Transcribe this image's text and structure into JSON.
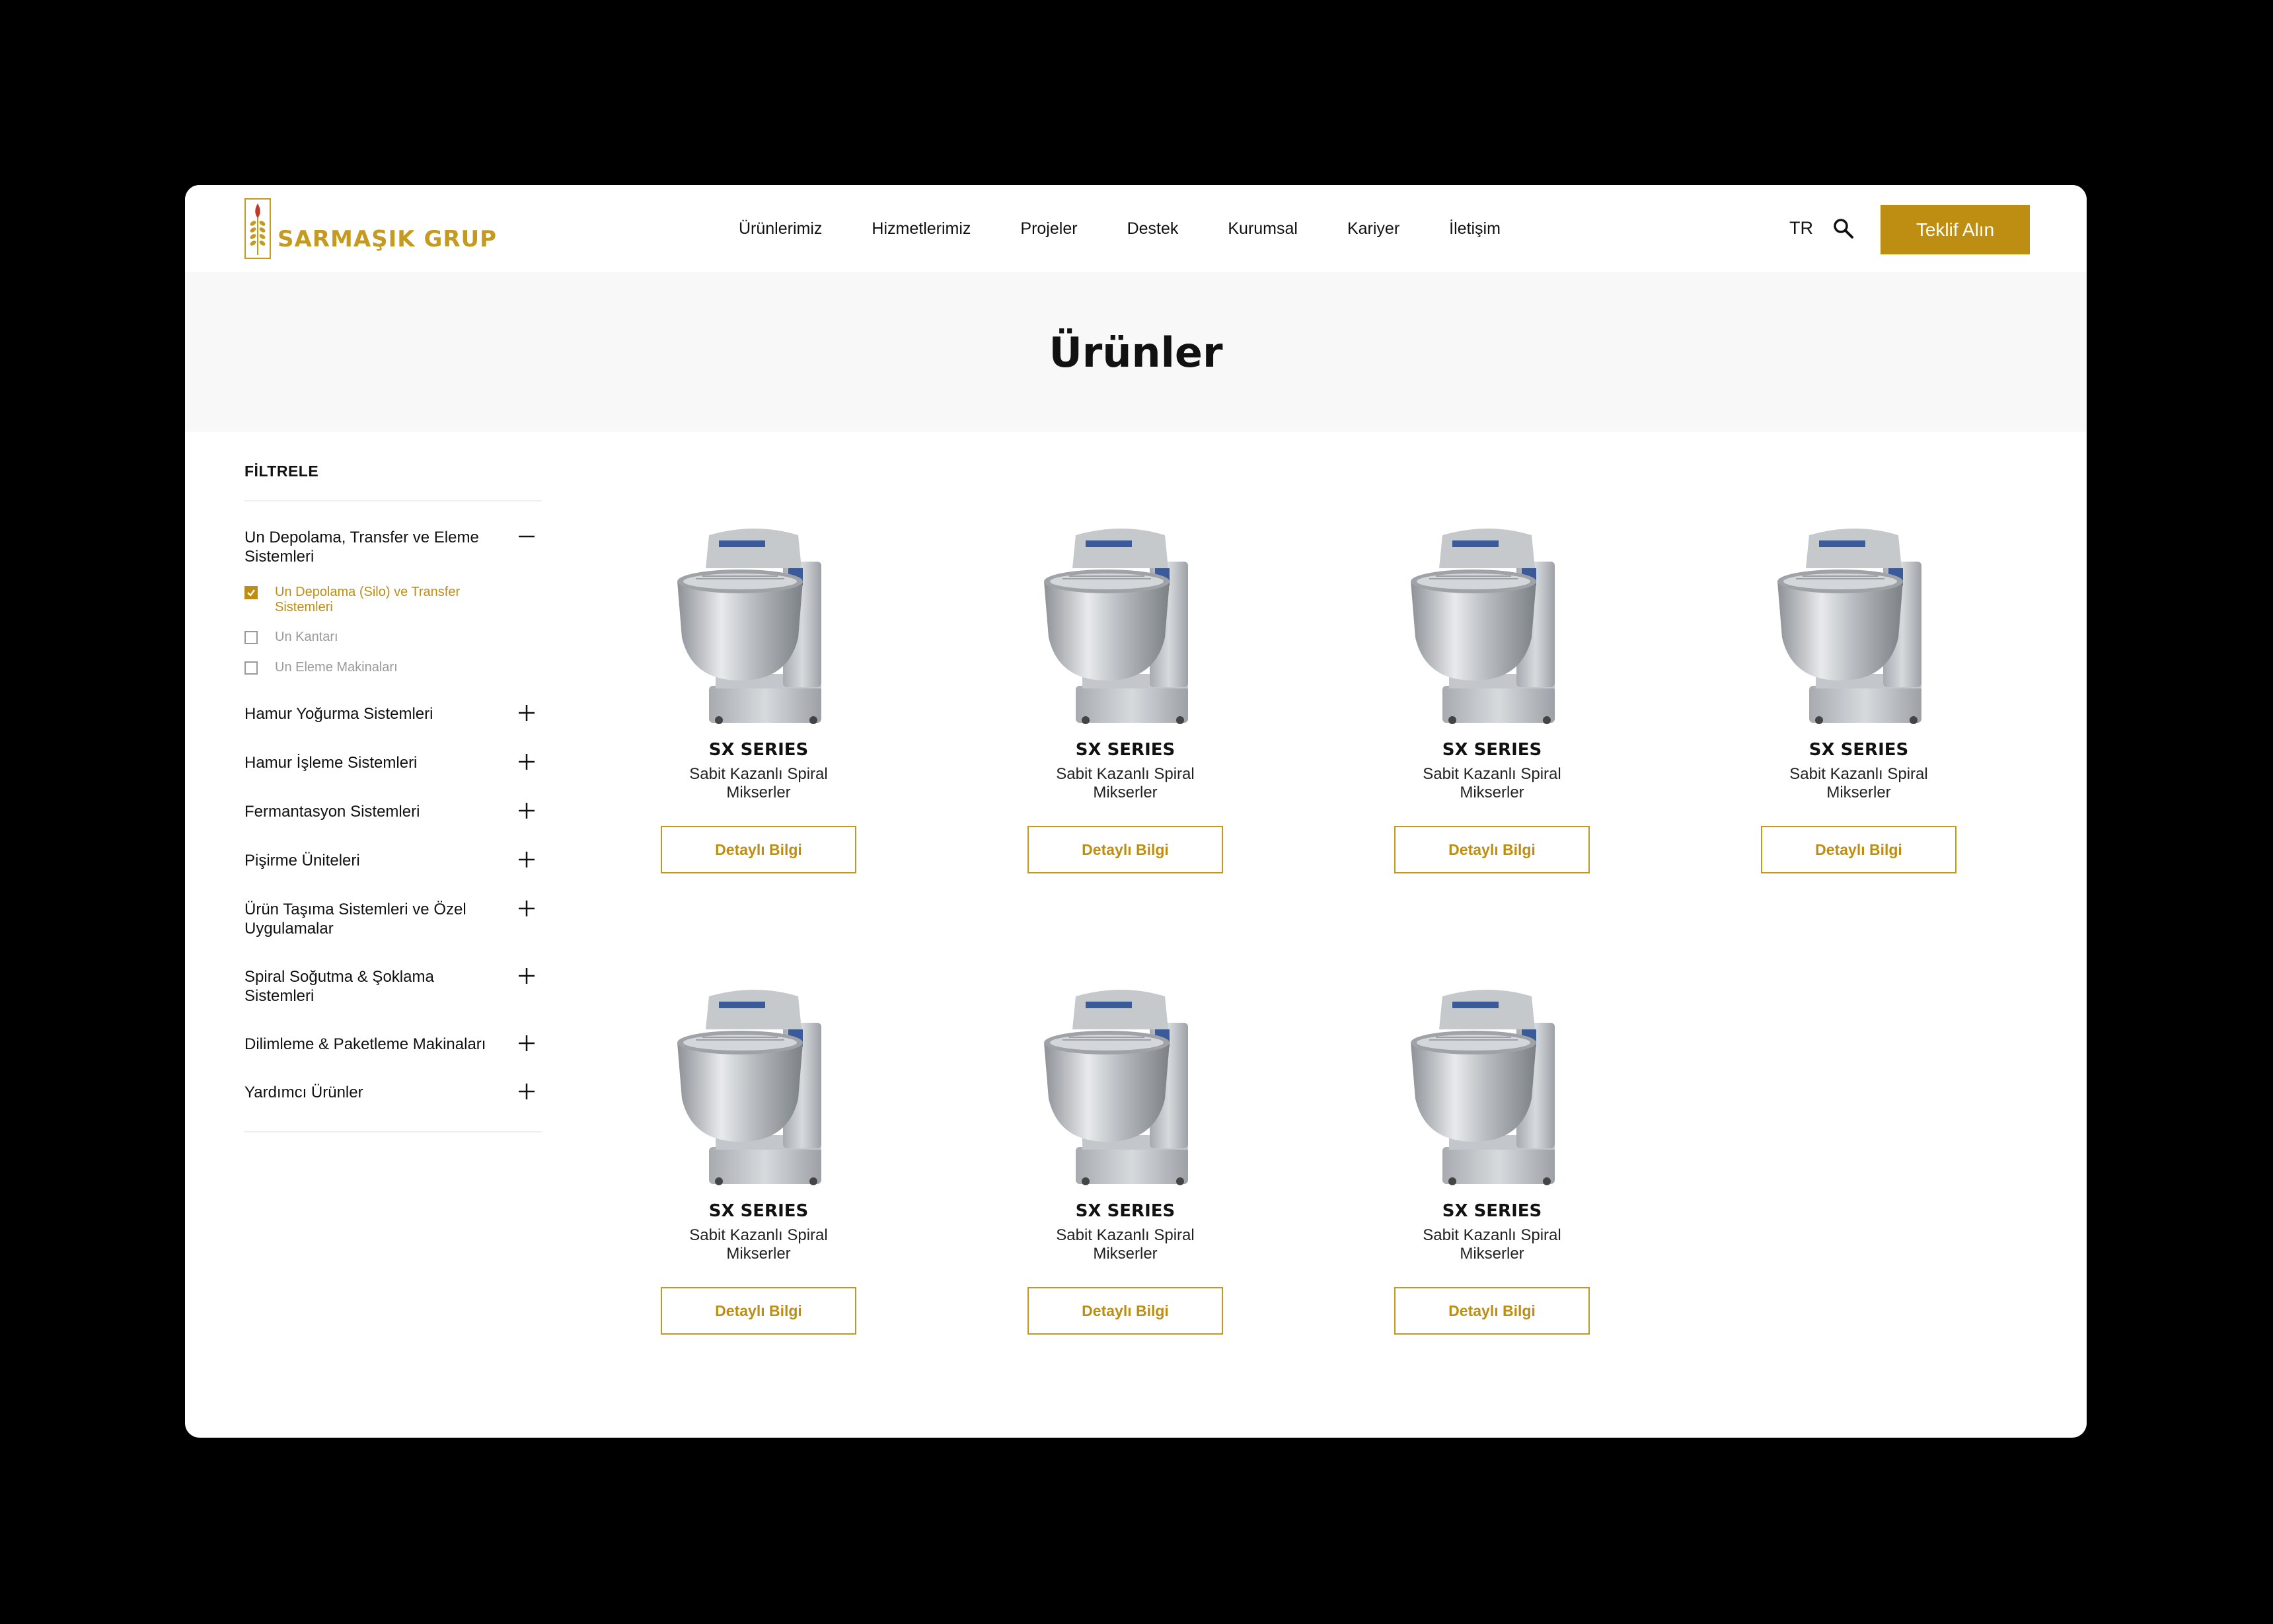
{
  "brand": {
    "name": "SARMAŞIK GRUP",
    "accent": "#bd8e12",
    "logo_icon": "wheat-logo-icon"
  },
  "nav": {
    "items": [
      "Ürünlerimiz",
      "Hizmetlerimiz",
      "Projeler",
      "Destek",
      "Kurumsal",
      "Kariyer",
      "İletişim"
    ]
  },
  "header": {
    "lang": "TR",
    "search_icon": "search-icon",
    "cta": "Teklif Alın"
  },
  "hero": {
    "title": "Ürünler"
  },
  "filter": {
    "title": "FİLTRELE",
    "categories": [
      {
        "label": "Un Depolama, Transfer ve Eleme Sistemleri",
        "expanded": true,
        "subs": [
          {
            "label": "Un Depolama (Silo) ve Transfer Sistemleri",
            "checked": true
          },
          {
            "label": "Un Kantarı",
            "checked": false
          },
          {
            "label": "Un Eleme Makinaları",
            "checked": false
          }
        ]
      },
      {
        "label": "Hamur Yoğurma Sistemleri",
        "expanded": false
      },
      {
        "label": "Hamur İşleme Sistemleri",
        "expanded": false
      },
      {
        "label": "Fermantasyon Sistemleri",
        "expanded": false
      },
      {
        "label": "Pişirme Üniteleri",
        "expanded": false
      },
      {
        "label": "Ürün Taşıma Sistemleri ve Özel Uygulamalar",
        "expanded": false
      },
      {
        "label": "Spiral Soğutma & Şoklama Sistemleri",
        "expanded": false
      },
      {
        "label": "Dilimleme & Paketleme Makinaları",
        "expanded": false
      },
      {
        "label": "Yardımcı Ürünler",
        "expanded": false
      }
    ]
  },
  "products": [
    {
      "name": "SX SERIES",
      "desc": "Sabit Kazanlı Spiral Mikserler",
      "button": "Detaylı Bilgi"
    },
    {
      "name": "SX SERIES",
      "desc": "Sabit Kazanlı Spiral Mikserler",
      "button": "Detaylı Bilgi"
    },
    {
      "name": "SX SERIES",
      "desc": "Sabit Kazanlı Spiral Mikserler",
      "button": "Detaylı Bilgi"
    },
    {
      "name": "SX SERIES",
      "desc": "Sabit Kazanlı Spiral Mikserler",
      "button": "Detaylı Bilgi"
    },
    {
      "name": "SX SERIES",
      "desc": "Sabit Kazanlı Spiral Mikserler",
      "button": "Detaylı Bilgi"
    },
    {
      "name": "SX SERIES",
      "desc": "Sabit Kazanlı Spiral Mikserler",
      "button": "Detaylı Bilgi"
    },
    {
      "name": "SX SERIES",
      "desc": "Sabit Kazanlı Spiral Mikserler",
      "button": "Detaylı Bilgi"
    }
  ]
}
